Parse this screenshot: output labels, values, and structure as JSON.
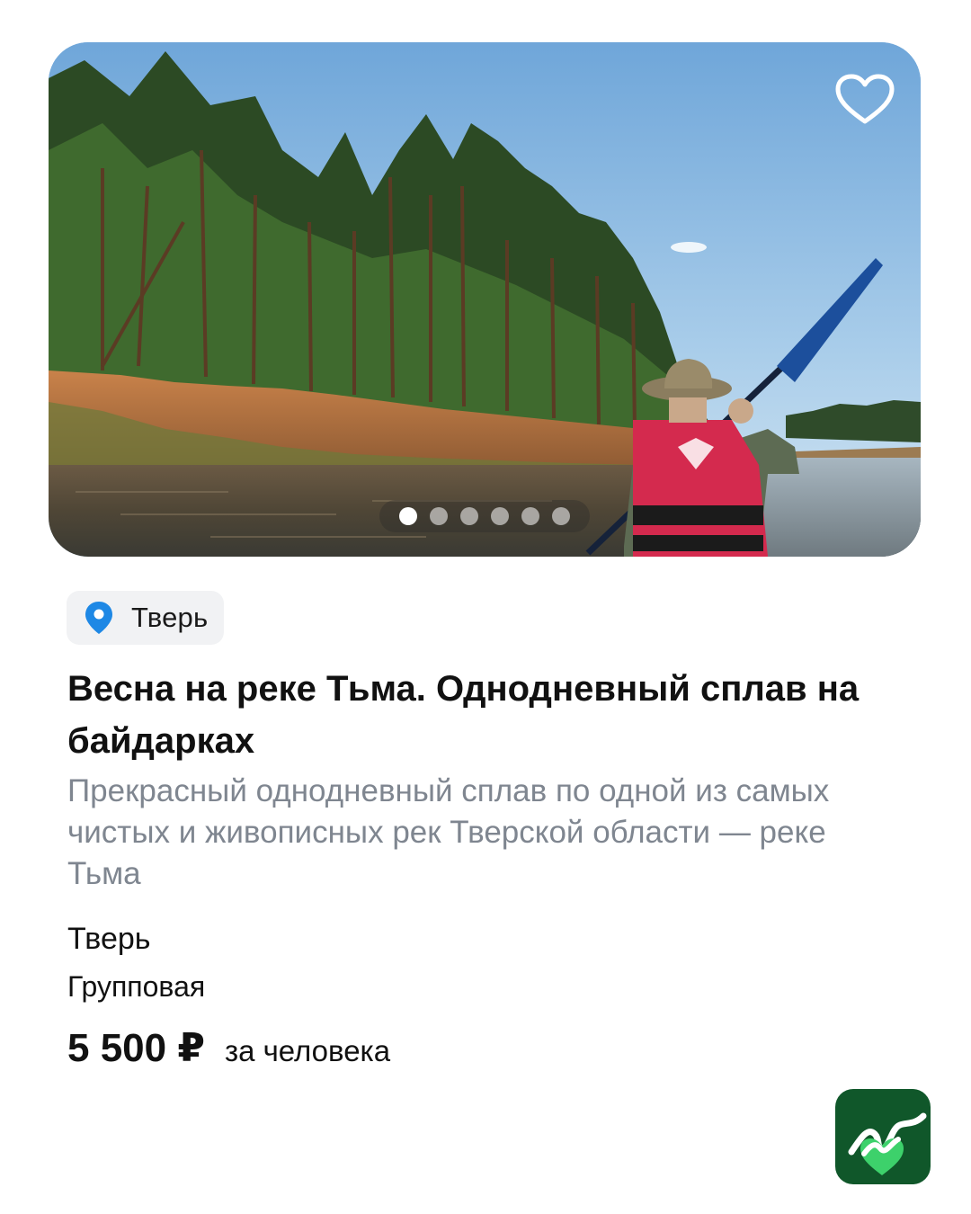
{
  "card": {
    "photo_name": "kayak-on-river-photo",
    "favorite_icon": "heart-outline-icon",
    "pager": {
      "total": 6,
      "active_index": 0
    },
    "location_chip": {
      "icon": "map-pin-icon",
      "label": "Тверь"
    },
    "title": "Весна на реке Тьма. Однодневный сплав на байдарках",
    "description": "Прекрасный однодневный сплав по одной из самых чистых и живописных рек Тверской области — реке Тьма",
    "city": "Тверь",
    "tour_type": "Групповая",
    "price": "5 500 ₽",
    "price_unit": "за человека"
  },
  "brand_logo": "brand-logo-icon",
  "colors": {
    "pin_blue": "#1e88e5",
    "muted_text": "#7f8690",
    "chip_bg": "#f1f2f4",
    "logo_green": "#10572a",
    "logo_heart": "#3dd16b"
  }
}
